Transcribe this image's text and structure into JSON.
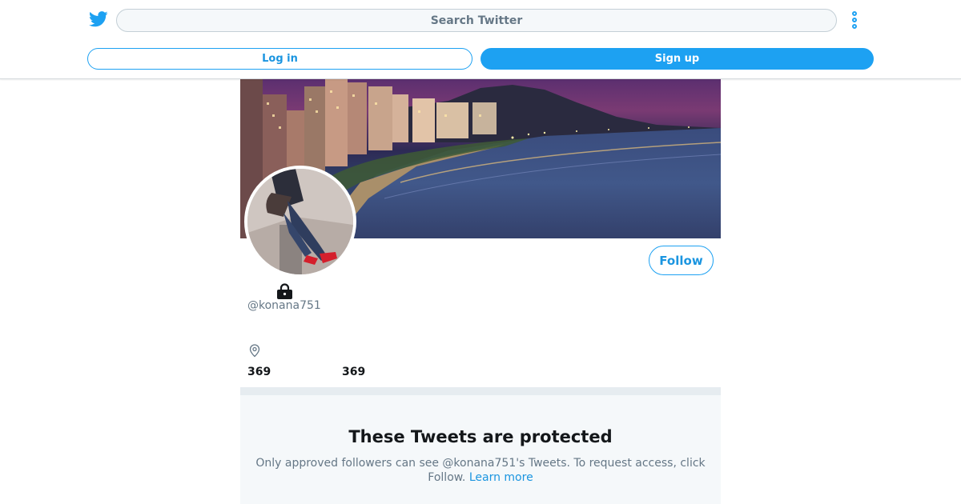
{
  "header": {
    "logo_icon": "twitter-bird-icon",
    "search_placeholder": "Search Twitter",
    "more_icon": "more-vertical-icon",
    "login_label": "Log in",
    "signup_label": "Sign up"
  },
  "profile": {
    "handle": "@konana751",
    "follow_label": "Follow",
    "lock_icon": "lock-icon",
    "location_icon": "location-pin-icon",
    "stats": [
      "369",
      "369"
    ]
  },
  "protected": {
    "title": "These Tweets are protected",
    "text": "Only approved followers can see @konana751's Tweets. To request access, click Follow.",
    "link": "Learn more"
  },
  "colors": {
    "accent": "#1da1f2",
    "link": "#1b95e0",
    "muted_text": "#657786",
    "panel_bg": "#f5f8fa"
  }
}
